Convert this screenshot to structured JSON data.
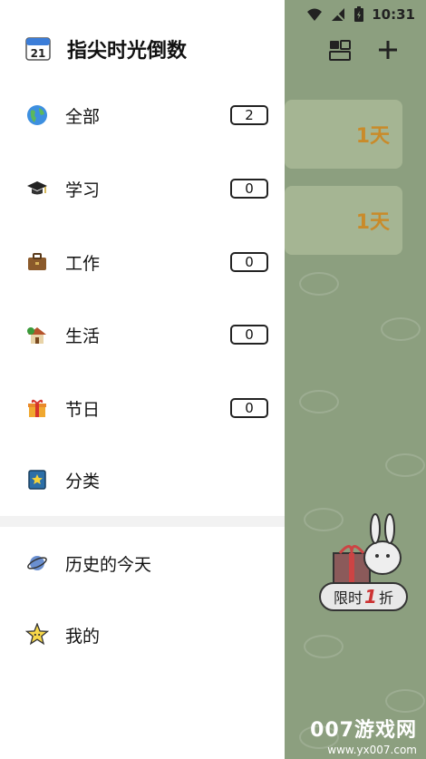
{
  "status_bar": {
    "time": "10:31"
  },
  "drawer": {
    "app_title": "指尖时光倒数",
    "calendar_icon_day": "21",
    "categories": [
      {
        "label": "全部",
        "count": "2",
        "icon": "globe-icon"
      },
      {
        "label": "学习",
        "count": "0",
        "icon": "graduation-cap-icon"
      },
      {
        "label": "工作",
        "count": "0",
        "icon": "briefcase-icon"
      },
      {
        "label": "生活",
        "count": "0",
        "icon": "house-icon"
      },
      {
        "label": "节日",
        "count": "0",
        "icon": "gift-icon"
      }
    ],
    "classify_label": "分类",
    "history_label": "历史的今天",
    "mine_label": "我的"
  },
  "background": {
    "cards": [
      {
        "days": "1天"
      },
      {
        "days": "1天"
      }
    ],
    "promo": {
      "prefix": "限时",
      "number": "1",
      "suffix": "折"
    }
  },
  "watermark": {
    "title": "007游戏网",
    "url": "www.yx007.com"
  },
  "colors": {
    "accent": "#c98b2a",
    "background": "#8c9f7f",
    "drawer": "#ffffff"
  }
}
